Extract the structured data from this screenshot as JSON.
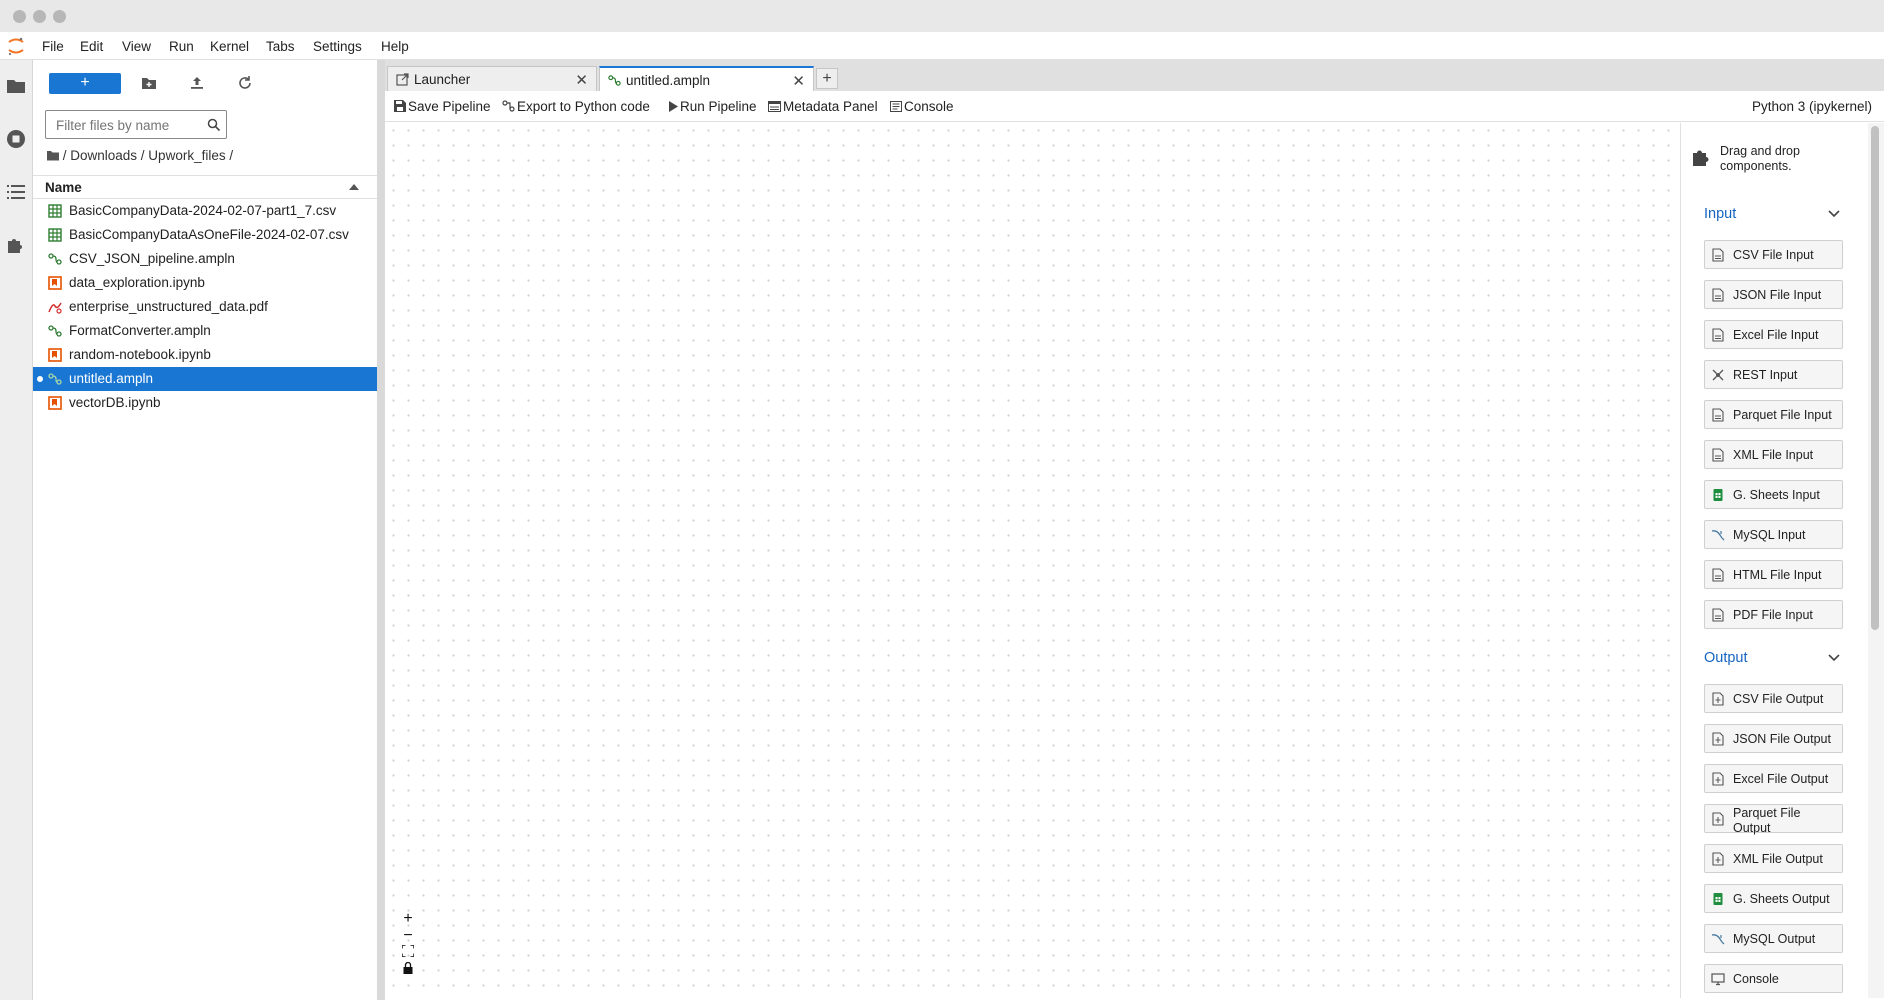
{
  "menubar": {
    "items": [
      "File",
      "Edit",
      "View",
      "Run",
      "Kernel",
      "Tabs",
      "Settings",
      "Help"
    ]
  },
  "filebrowser": {
    "new_label": "+",
    "filter_placeholder": "Filter files by name",
    "breadcrumb": "/ Downloads / Upwork_files /",
    "column_name": "Name",
    "files": [
      {
        "name": "BasicCompanyData-2024-02-07-part1_7.csv",
        "icon": "csv-icon"
      },
      {
        "name": "BasicCompanyDataAsOneFile-2024-02-07.csv",
        "icon": "csv-icon"
      },
      {
        "name": "CSV_JSON_pipeline.ampln",
        "icon": "pipeline-icon"
      },
      {
        "name": "data_exploration.ipynb",
        "icon": "notebook-icon"
      },
      {
        "name": "enterprise_unstructured_data.pdf",
        "icon": "pdf-icon"
      },
      {
        "name": "FormatConverter.ampln",
        "icon": "pipeline-icon"
      },
      {
        "name": "random-notebook.ipynb",
        "icon": "notebook-icon"
      },
      {
        "name": "untitled.ampln",
        "icon": "pipeline-icon",
        "selected": true
      },
      {
        "name": "vectorDB.ipynb",
        "icon": "notebook-icon"
      }
    ]
  },
  "tabs": [
    {
      "label": "Launcher",
      "icon": "launcher-icon",
      "active": false
    },
    {
      "label": "untitled.ampln",
      "icon": "pipeline-icon",
      "active": true
    }
  ],
  "tab_add_label": "+",
  "toolbar": {
    "save": "Save Pipeline",
    "export": "Export to Python code",
    "run": "Run Pipeline",
    "metadata": "Metadata Panel",
    "console": "Console",
    "kernel": "Python 3 (ipykernel)"
  },
  "zoom": {
    "in": "+",
    "out": "−"
  },
  "palette": {
    "hint": "Drag and drop components.",
    "sections": [
      {
        "title": "Input",
        "items": [
          "CSV File Input",
          "JSON File Input",
          "Excel File Input",
          "REST Input",
          "Parquet File Input",
          "XML File Input",
          "G. Sheets Input",
          "MySQL Input",
          "HTML File Input",
          "PDF File Input"
        ]
      },
      {
        "title": "Output",
        "items": [
          "CSV File Output",
          "JSON File Output",
          "Excel File Output",
          "Parquet File Output",
          "XML File Output",
          "G. Sheets Output",
          "MySQL Output",
          "Console"
        ]
      }
    ]
  },
  "colors": {
    "accent": "#1976d2",
    "csv": "#2e7d32",
    "notebook": "#e65100",
    "pdf": "#d32f2f",
    "sheets": "#1e8e3e"
  }
}
